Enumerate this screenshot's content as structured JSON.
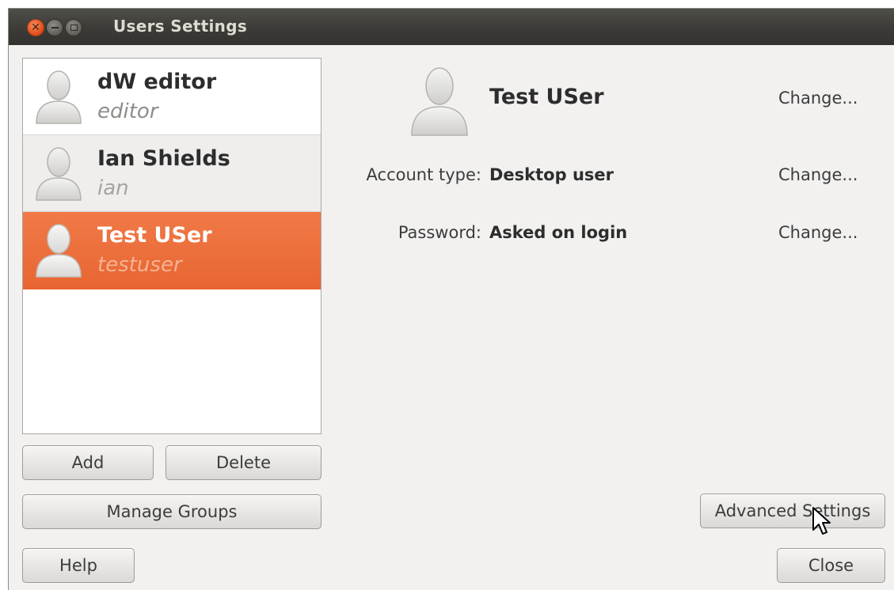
{
  "window": {
    "title": "Users Settings",
    "controls": {
      "close": "×",
      "minimize": "–",
      "maximize": "□"
    }
  },
  "users": [
    {
      "name": "dW editor",
      "login": "editor",
      "selected": false
    },
    {
      "name": "Ian Shields",
      "login": "ian",
      "selected": false
    },
    {
      "name": "Test USer",
      "login": "testuser",
      "selected": true
    }
  ],
  "list_buttons": {
    "add": "Add",
    "delete": "Delete",
    "manage_groups": "Manage Groups"
  },
  "details": {
    "name": "Test USer",
    "name_change": "Change...",
    "account_type_label": "Account type:",
    "account_type_value": "Desktop user",
    "account_type_change": "Change...",
    "password_label": "Password:",
    "password_value": "Asked on login",
    "password_change": "Change..."
  },
  "footer": {
    "advanced_settings": "Advanced Settings",
    "help": "Help",
    "close": "Close"
  },
  "colors": {
    "selection": "#e86532",
    "titlebar": "#3c3b37",
    "window_bg": "#f2f1f0"
  },
  "icons": [
    "user-avatar-icon",
    "mouse-pointer-icon"
  ]
}
